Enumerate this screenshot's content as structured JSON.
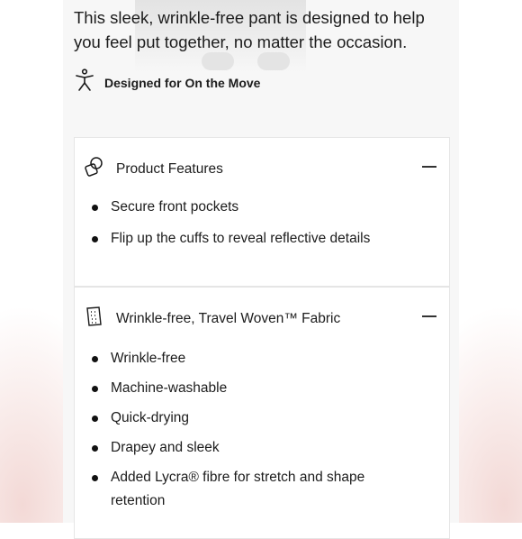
{
  "intro": {
    "text": "This sleek, wrinkle-free pant is designed to help you feel put together, no matter the occasion."
  },
  "designed_for": {
    "icon": "person-moving-icon",
    "label": "Designed for On the Move"
  },
  "sections": [
    {
      "icon": "overlapping-shapes-icon",
      "title": "Product Features",
      "expanded": true,
      "items": [
        "Secure front pockets",
        "Flip up the cuffs to reveal reflective details"
      ]
    },
    {
      "icon": "fabric-swatch-icon",
      "title": "Wrinkle-free, Travel Woven™ Fabric",
      "expanded": true,
      "items": [
        "Wrinkle-free",
        "Machine-washable",
        "Quick-drying",
        "Drapey and sleek",
        "Added Lycra® fibre for stretch and shape retention"
      ]
    }
  ]
}
